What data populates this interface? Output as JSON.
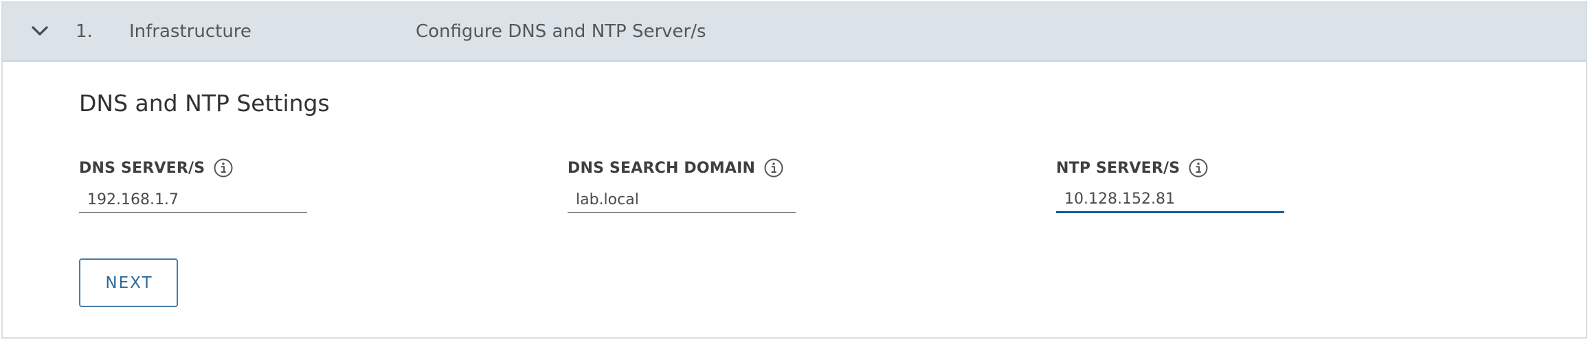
{
  "step": {
    "number": "1.",
    "title": "Infrastructure",
    "description": "Configure DNS and NTP Server/s",
    "expand_icon": "chevron-down-icon"
  },
  "section": {
    "title": "DNS and NTP Settings"
  },
  "fields": {
    "dns_servers": {
      "label": "DNS SERVER/S",
      "value": "192.168.1.7",
      "icon": "info-icon"
    },
    "dns_search_domain": {
      "label": "DNS SEARCH DOMAIN",
      "value": "lab.local",
      "icon": "info-icon"
    },
    "ntp_servers": {
      "label": "NTP SERVER/S",
      "value": "10.128.152.81",
      "icon": "info-icon"
    }
  },
  "actions": {
    "next_label": "NEXT"
  },
  "colors": {
    "header_background": "#dbe3e9",
    "active_input_border": "#0f5f98",
    "button_text": "#2f6b99"
  }
}
